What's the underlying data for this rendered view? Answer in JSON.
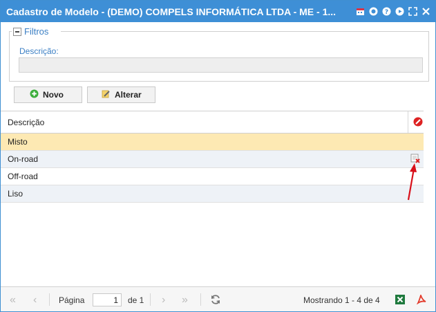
{
  "window": {
    "title": "Cadastro de Modelo - (DEMO) COMPELS INFORMÁTICA LTDA - ME - 1..."
  },
  "filters": {
    "legend": "Filtros",
    "description_label": "Descrição:",
    "description_value": ""
  },
  "buttons": {
    "new": "Novo",
    "edit": "Alterar"
  },
  "grid": {
    "column_header": "Descrição",
    "rows": [
      "Misto",
      "On-road",
      "Off-road",
      "Liso"
    ]
  },
  "pager": {
    "page_label": "Página",
    "page_value": "1",
    "of_label": "de 1",
    "summary": "Mostrando 1 - 4 de 4"
  },
  "colors": {
    "title_bar": "#3e8fd6",
    "selected_row": "#fde9b3",
    "accent_text": "#3b7fc4"
  }
}
